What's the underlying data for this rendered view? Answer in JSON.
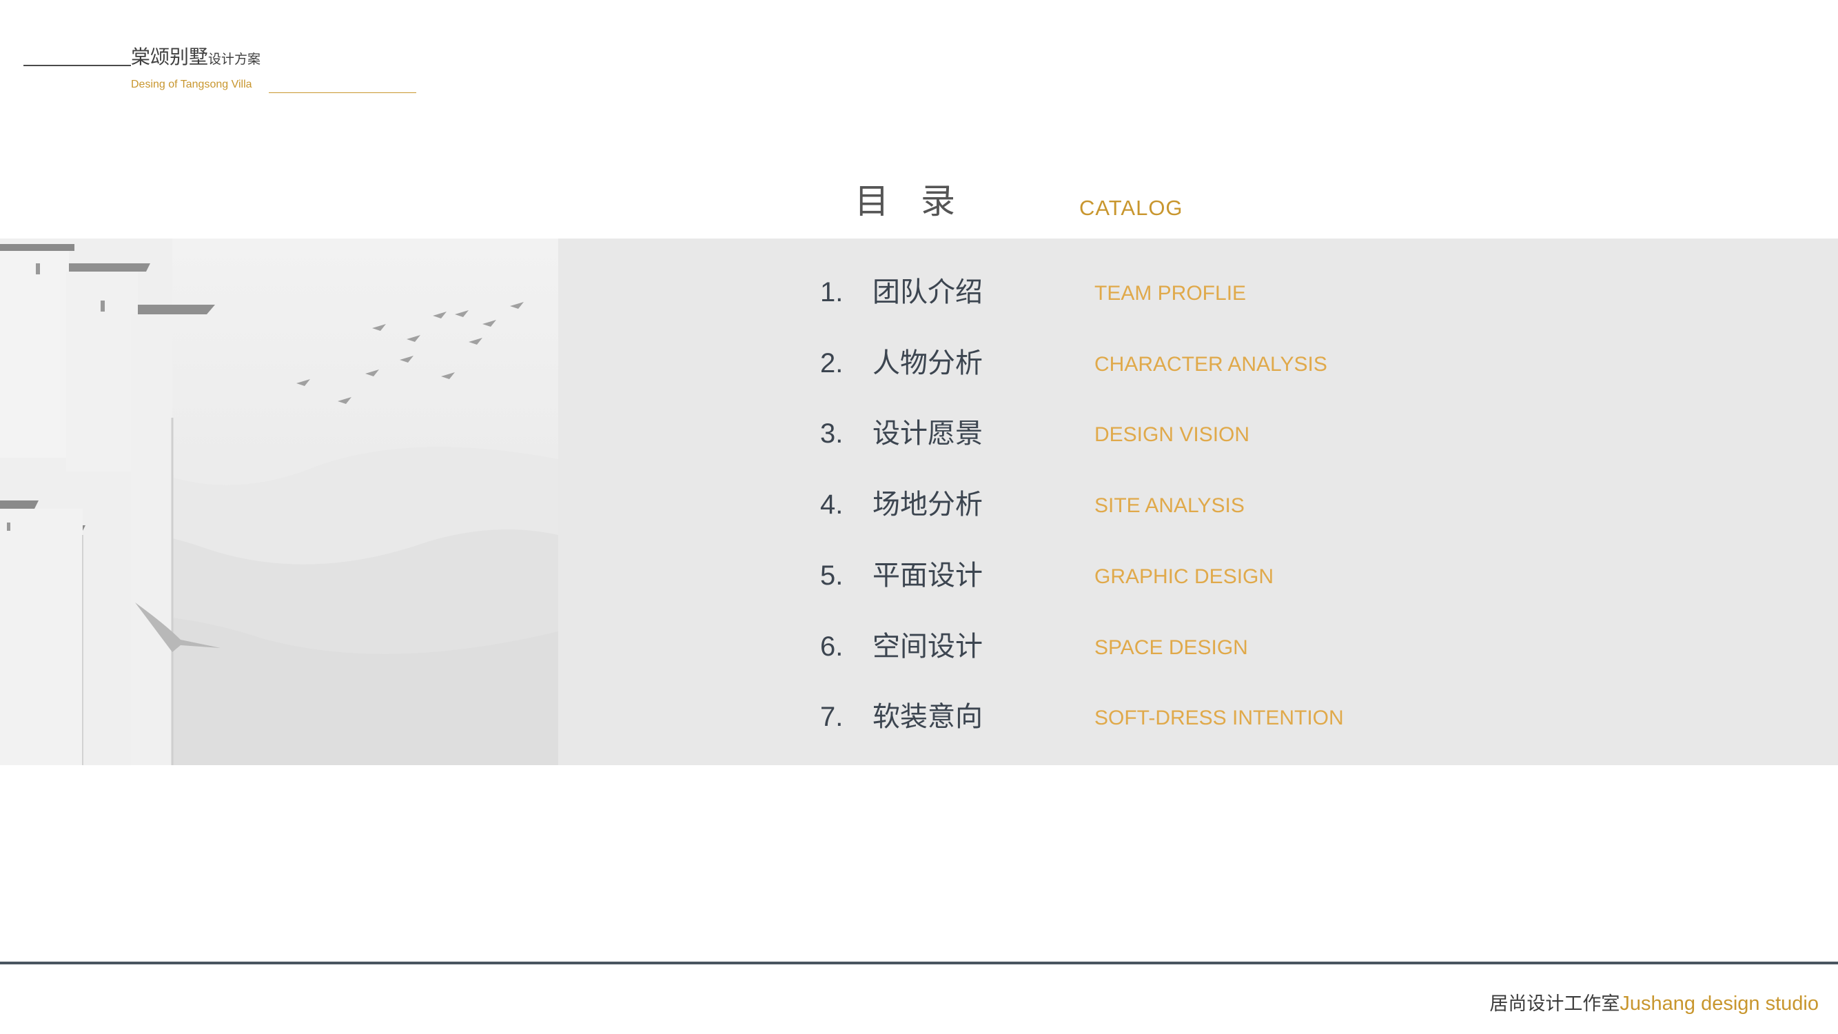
{
  "header": {
    "title_main": "棠颂别墅",
    "title_sub": "设计方案",
    "subtitle": "Desing of Tangsong Villa"
  },
  "catalog": {
    "title_cn": "目录",
    "title_en": "CATALOG"
  },
  "toc": [
    {
      "num": "1.",
      "cn": "团队介绍",
      "en": "TEAM PROFLIE"
    },
    {
      "num": "2.",
      "cn": "人物分析",
      "en": "CHARACTER ANALYSIS"
    },
    {
      "num": "3.",
      "cn": "设计愿景",
      "en": "DESIGN VISION"
    },
    {
      "num": "4.",
      "cn": "场地分析",
      "en": "SITE ANALYSIS"
    },
    {
      "num": "5.",
      "cn": "平面设计",
      "en": "GRAPHIC DESIGN"
    },
    {
      "num": "6.",
      "cn": "空间设计",
      "en": "SPACE DESIGN"
    },
    {
      "num": "7.",
      "cn": "软装意向",
      "en": "SOFT-DRESS INTENTION"
    }
  ],
  "footer": {
    "studio_cn": "居尚设计工作室",
    "studio_en": "Jushang design studio"
  },
  "colors": {
    "accent": "#c8962e",
    "text_dark": "#3c4550",
    "band": "#e8e8e8"
  }
}
